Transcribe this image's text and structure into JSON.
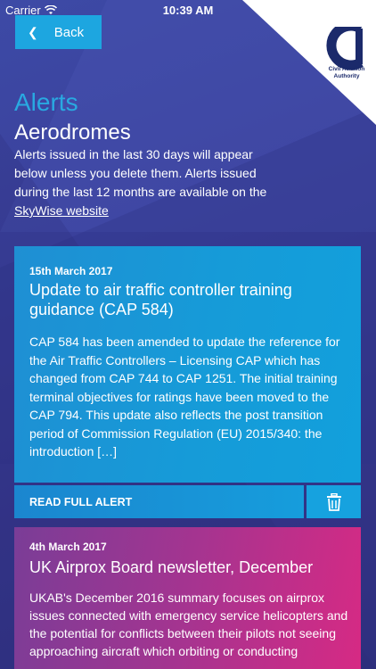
{
  "status_bar": {
    "carrier": "Carrier",
    "time": "10:39 AM"
  },
  "nav": {
    "back_label": "Back"
  },
  "logo": {
    "text": "Civil Aviation Authority"
  },
  "header": {
    "title": "Alerts",
    "subtitle": "Aerodromes"
  },
  "intro": {
    "text": "Alerts issued in the last 30 days will appear below unless you delete them. Alerts issued during the last 12 months are available on the ",
    "link_text": "SkyWise website"
  },
  "alerts": [
    {
      "date": "15th March 2017",
      "title": "Update to air traffic controller training guidance (CAP 584)",
      "body": "CAP 584 has been amended to update the reference for the Air Traffic Controllers – Licensing CAP which has changed from CAP 744 to CAP 1251. The initial training terminal objectives for ratings have been moved to the CAP 794. This update also reflects the post transition period of Commission Regulation (EU) 2015/340: the introduction […]",
      "read_label": "READ FULL ALERT",
      "delete_icon": "trash-icon"
    },
    {
      "date": "4th March 2017",
      "title": "UK Airprox Board newsletter, December",
      "body": "UKAB's December 2016 summary focuses on airprox issues connected with emergency service helicopters and the potential for conflicts between their pilots not seeing approaching aircraft which orbiting or conducting"
    }
  ],
  "colors": {
    "accent": "#1da6e0",
    "alerts_title": "#29a9e1",
    "card_blue": "#169bd8",
    "card_magenta": "#d62a84"
  }
}
